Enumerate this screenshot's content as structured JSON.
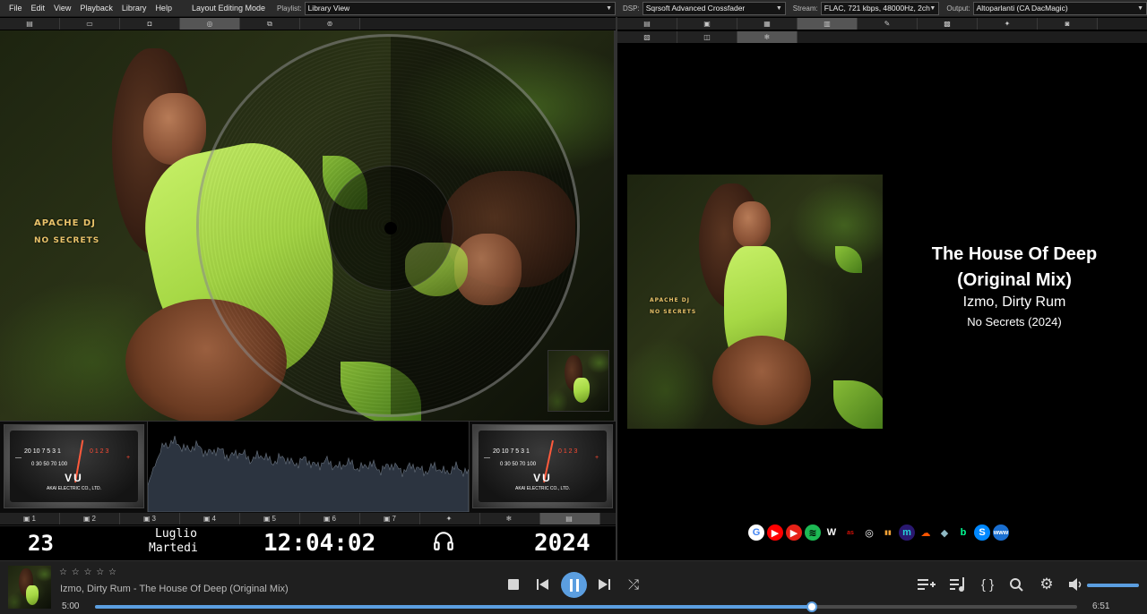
{
  "menu": [
    "File",
    "Edit",
    "View",
    "Playback",
    "Library",
    "Help"
  ],
  "layout_mode": "Layout Editing Mode",
  "toolbar": {
    "playlist_label": "Playlist:",
    "playlist_value": "Library View",
    "dsp_label": "DSP:",
    "dsp_value": "Sqrsoft Advanced Crossfader",
    "stream_label": "Stream:",
    "stream_value": "FLAC, 721 kbps, 48000Hz, 2ch",
    "output_label": "Output:",
    "output_value": "Altoparlanti (CA DacMagic)"
  },
  "left_tabs": [
    {
      "icon": "▤",
      "active": false
    },
    {
      "icon": "▭",
      "active": false
    },
    {
      "icon": "◘",
      "active": false
    },
    {
      "icon": "◎",
      "active": true
    },
    {
      "icon": "⧉",
      "active": false
    },
    {
      "icon": "⊚",
      "active": false
    }
  ],
  "right_tabs_row1": [
    {
      "icon": "▤",
      "active": false
    },
    {
      "icon": "▣",
      "active": false
    },
    {
      "icon": "▦",
      "active": false
    },
    {
      "icon": "▥",
      "active": true
    },
    {
      "icon": "✎",
      "active": false
    },
    {
      "icon": "▩",
      "active": false
    },
    {
      "icon": "✦",
      "active": false
    },
    {
      "icon": "◙",
      "active": false
    }
  ],
  "right_tabs_row2": [
    {
      "icon": "▧",
      "active": false
    },
    {
      "icon": "◫",
      "active": false
    },
    {
      "icon": "❄",
      "active": true
    }
  ],
  "cover_text": {
    "artist": "APACHE DJ",
    "album": "NO SECRETS"
  },
  "vu": {
    "scale_white": "20 10 7 5 3 1",
    "scale_red": "0  1  2  3",
    "scale_lower": "0  30  50  70  100",
    "label": "VU",
    "brand": "AKAI ELECTRIC CO., LTD.",
    "minus": "—",
    "plus": "+"
  },
  "bottom_tabs": [
    {
      "icon": "▣",
      "num": "1",
      "active": false
    },
    {
      "icon": "▣",
      "num": "2",
      "active": false
    },
    {
      "icon": "▣",
      "num": "3",
      "active": false
    },
    {
      "icon": "▣",
      "num": "4",
      "active": false
    },
    {
      "icon": "▣",
      "num": "5",
      "active": false
    },
    {
      "icon": "▣",
      "num": "6",
      "active": false
    },
    {
      "icon": "▣",
      "num": "7",
      "active": false
    },
    {
      "icon": "✦",
      "num": "",
      "active": false
    },
    {
      "icon": "❄",
      "num": "",
      "active": false
    },
    {
      "icon": "▤",
      "num": "",
      "active": true
    }
  ],
  "clock": {
    "day": "23",
    "month": "Luglio",
    "weekday": "Martedi",
    "time": "12:04:02",
    "year": "2024"
  },
  "now_playing": {
    "title": "The House Of Deep",
    "title2": "(Original Mix)",
    "artists": "Izmo, Dirty Rum",
    "album": "No Secrets (2024)"
  },
  "social_icons": [
    {
      "name": "google-icon",
      "glyph": "G",
      "color": "#ffffff",
      "fg": "#4285f4"
    },
    {
      "name": "youtube-icon",
      "glyph": "▶",
      "color": "#ff0000",
      "fg": "#ffffff"
    },
    {
      "name": "youtube-music-icon",
      "glyph": "▶",
      "color": "#e62117",
      "fg": "#ffffff"
    },
    {
      "name": "spotify-icon",
      "glyph": "≋",
      "color": "#1db954",
      "fg": "#000000"
    },
    {
      "name": "wikipedia-icon",
      "glyph": "W",
      "color": "#000000",
      "fg": "#ffffff"
    },
    {
      "name": "lastfm-icon",
      "glyph": "as",
      "color": "#000000",
      "fg": "#d51007"
    },
    {
      "name": "discogs-icon",
      "glyph": "◎",
      "color": "#000000",
      "fg": "#ffffff"
    },
    {
      "name": "deezer-icon",
      "glyph": "▮▮",
      "color": "#000000",
      "fg": "#f4a236"
    },
    {
      "name": "amazon-music-icon",
      "glyph": "m",
      "color": "#2a1870",
      "fg": "#25d1da"
    },
    {
      "name": "soundcloud-icon",
      "glyph": "☁",
      "color": "#000000",
      "fg": "#ff5500"
    },
    {
      "name": "tidal-icon",
      "glyph": "◆",
      "color": "#000000",
      "fg": "#8fb9c4"
    },
    {
      "name": "beatport-icon",
      "glyph": "b",
      "color": "#000000",
      "fg": "#02ff95"
    },
    {
      "name": "shazam-icon",
      "glyph": "S",
      "color": "#0088ff",
      "fg": "#ffffff"
    },
    {
      "name": "web-icon",
      "glyph": "www",
      "color": "#1a6fd1",
      "fg": "#ffffff"
    }
  ],
  "player": {
    "rating": "☆ ☆ ☆ ☆ ☆",
    "track": "Izmo, Dirty Rum - The House Of Deep (Original Mix)",
    "elapsed": "5:00",
    "total": "6:51",
    "progress": 0.73,
    "volume": 1.0
  },
  "colors": {
    "accent": "#5b9ee0",
    "vu_red": "#ff4b34",
    "suit": "#b5e14f"
  }
}
